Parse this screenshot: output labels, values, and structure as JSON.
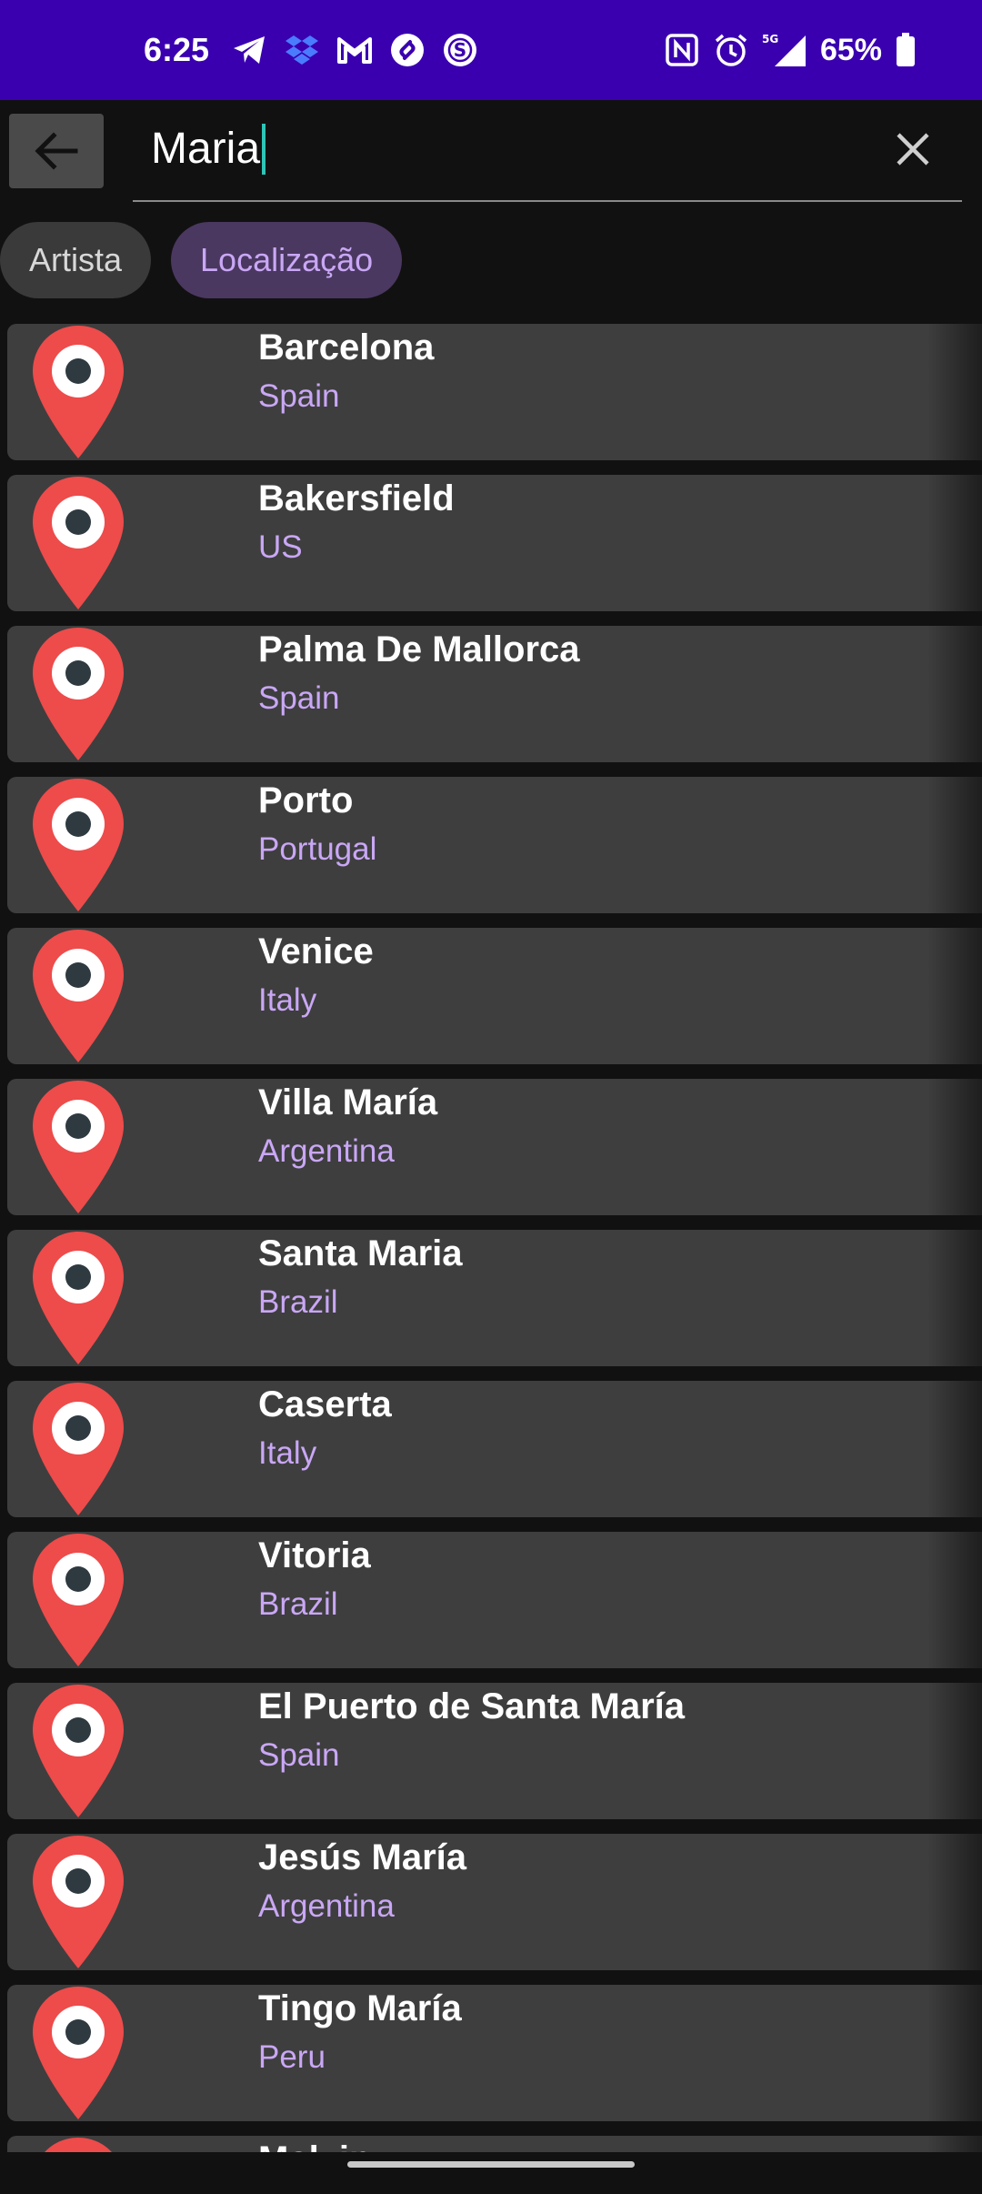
{
  "status_bar": {
    "time": "6:25",
    "notification_icons": [
      "telegram-icon",
      "dropbox-icon",
      "gmail-icon",
      "shazam-icon",
      "s-app-icon"
    ],
    "system_icons": [
      "nfc-icon",
      "alarm-icon",
      "signal-5g-icon"
    ],
    "battery_percent": "65%"
  },
  "search": {
    "query": "Maria"
  },
  "filters": {
    "chips": [
      {
        "label": "Artista",
        "selected": false
      },
      {
        "label": "Localização",
        "selected": true
      }
    ]
  },
  "results": [
    {
      "name": "Barcelona",
      "country": "Spain"
    },
    {
      "name": "Bakersfield",
      "country": "US"
    },
    {
      "name": "Palma De Mallorca",
      "country": "Spain"
    },
    {
      "name": "Porto",
      "country": "Portugal"
    },
    {
      "name": "Venice",
      "country": "Italy"
    },
    {
      "name": "Villa María",
      "country": "Argentina"
    },
    {
      "name": "Santa Maria",
      "country": "Brazil"
    },
    {
      "name": "Caserta",
      "country": "Italy"
    },
    {
      "name": "Vitoria",
      "country": "Brazil"
    },
    {
      "name": "El Puerto de Santa María",
      "country": "Spain"
    },
    {
      "name": "Jesús María",
      "country": "Argentina"
    },
    {
      "name": "Tingo María",
      "country": "Peru"
    },
    {
      "name": "Malvin",
      "country": ""
    }
  ],
  "colors": {
    "status_bar": "#3a00b0",
    "background": "#111111",
    "row": "#3e3e3e",
    "accent_text": "#c9a7f5",
    "pin": "#ee4b4b",
    "cursor": "#2ec4b6"
  }
}
